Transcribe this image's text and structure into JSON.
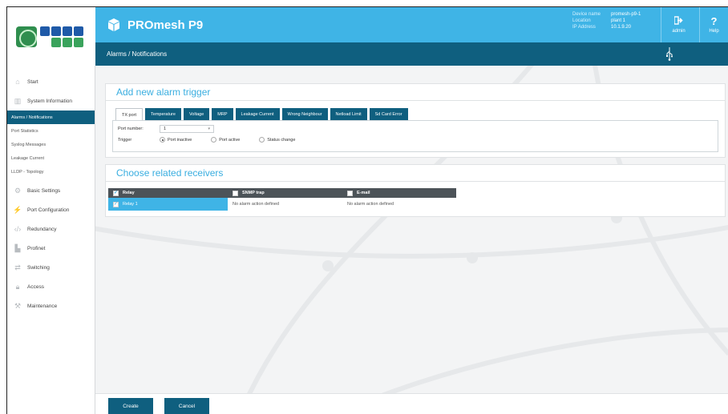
{
  "app": {
    "title": "PROmesh P9",
    "breadcrumb": "Alarms / Notifications"
  },
  "device": {
    "name_label": "Device name",
    "name_value": "promesh-p9-1",
    "location_label": "Location",
    "location_value": "plant 1",
    "ip_label": "IP Address",
    "ip_value": "10.1.9.20"
  },
  "topbar": {
    "admin_label": "admin",
    "help_label": "Help"
  },
  "sidebar": {
    "items": [
      {
        "label": "Start",
        "icon": "home-icon"
      },
      {
        "label": "System Information",
        "icon": "bar-chart-icon"
      },
      {
        "label": "Alarms / Notifications",
        "active": true
      },
      {
        "label": "Port Statistics"
      },
      {
        "label": "Syslog Messages"
      },
      {
        "label": "Leakage Current"
      },
      {
        "label": "LLDP - Topology"
      },
      {
        "label": "Basic Settings",
        "icon": "gear-icon"
      },
      {
        "label": "Port Configuration",
        "icon": "plug-icon"
      },
      {
        "label": "Redundancy",
        "icon": "code-icon"
      },
      {
        "label": "Profinet",
        "icon": "factory-icon"
      },
      {
        "label": "Switching",
        "icon": "shuffle-icon"
      },
      {
        "label": "Access",
        "icon": "lock-icon"
      },
      {
        "label": "Maintenance",
        "icon": "wrench-icon"
      }
    ]
  },
  "trigger": {
    "title": "Add new alarm trigger",
    "tabs": [
      "TX port",
      "Temperature",
      "Voltage",
      "MRP",
      "Leakage Current",
      "Wrong Neighbour",
      "Netload Limit",
      "Sd Card Error"
    ],
    "port_label": "Port number:",
    "port_value": "1",
    "trigger_label": "Trigger",
    "options": [
      "Port inactive",
      "Port active",
      "Status change"
    ],
    "selected_option": "Port inactive"
  },
  "receivers": {
    "title": "Choose related receivers",
    "columns": [
      "Relay",
      "SNMP trap",
      "E-mail"
    ],
    "rows": [
      {
        "relay": "Relay 1",
        "snmp": "No alarm action defined",
        "email": "No alarm action defined"
      }
    ]
  },
  "footer": {
    "create_label": "Create",
    "cancel_label": "Cancel"
  },
  "colors": {
    "header_blue": "#3fb4e6",
    "dark_teal": "#0f5f7f",
    "title_blue": "#3aaee0"
  }
}
